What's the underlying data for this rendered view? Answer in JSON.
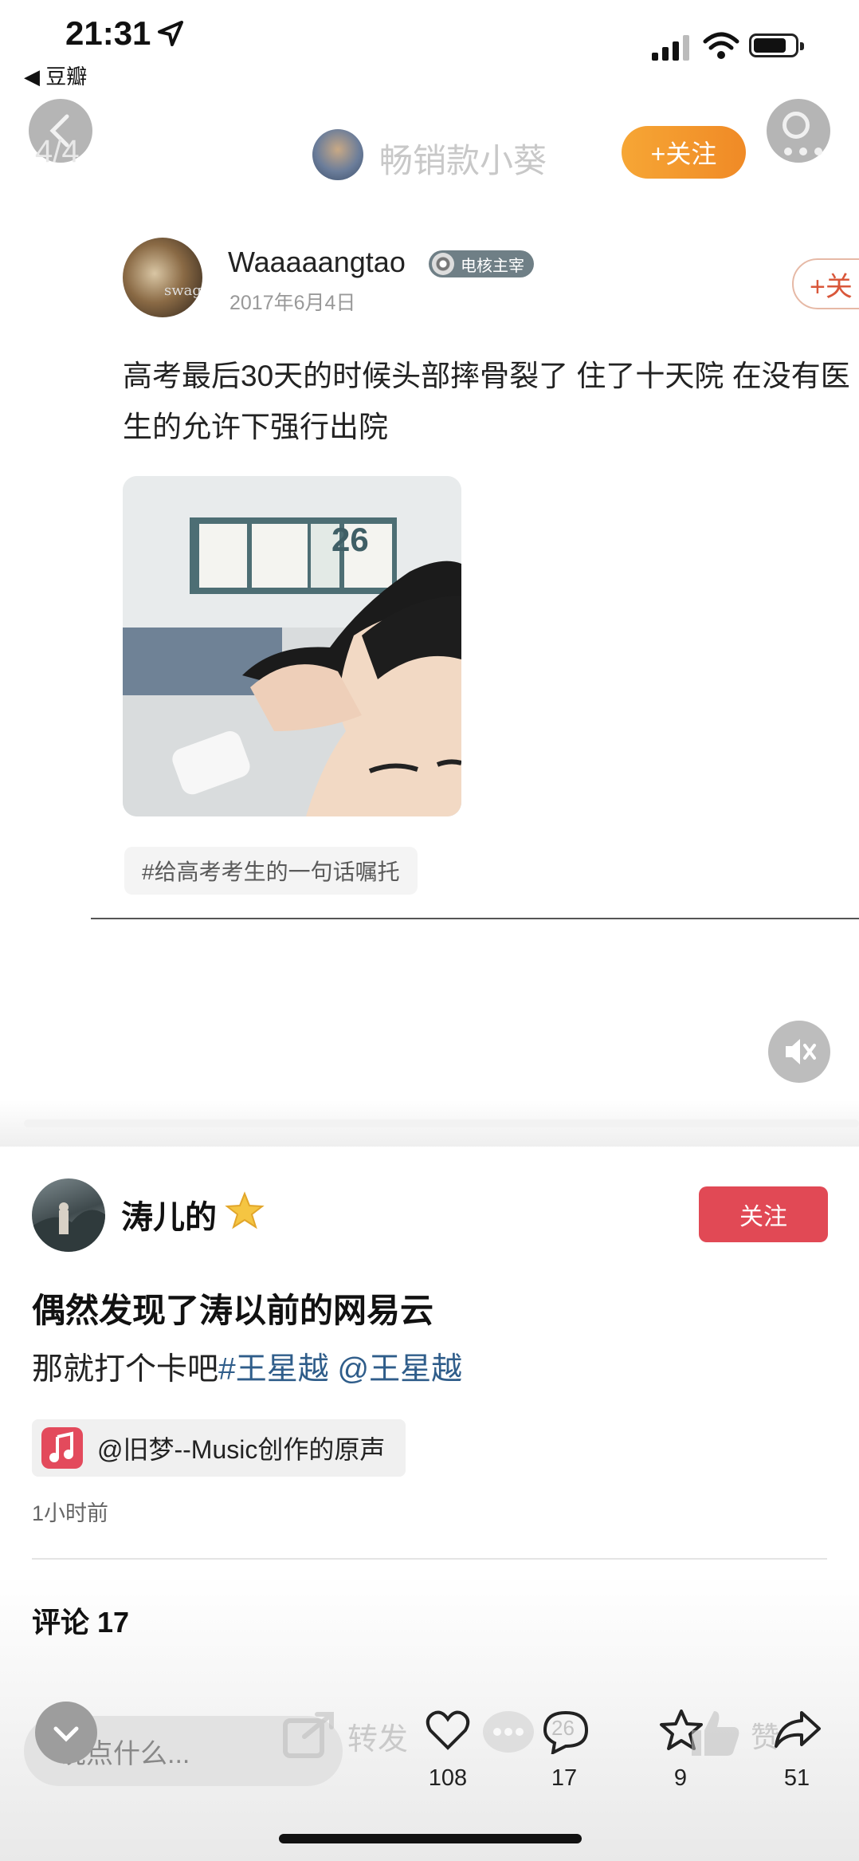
{
  "status_bar": {
    "time": "21:31",
    "back_app": "豆瓣"
  },
  "embed_header": {
    "counter": "4/4",
    "author_name": "畅销款小葵",
    "follow_label": "+关注"
  },
  "quoted_post": {
    "author": "Waaaaangtao",
    "badge": "电核主宰",
    "date": "2017年6月4日",
    "follow_label": "+关",
    "text": "高考最后30天的时候头部摔骨裂了 住了十天院 在没有医\n生的允许下强行出院",
    "photo_sign_number": "26",
    "hashtag": "#给高考考生的一句话嘱托"
  },
  "post": {
    "username": "涛儿的",
    "follow_label": "关注",
    "title": "偶然发现了涛以前的网易云",
    "body_prefix": "那就打个卡吧",
    "topic": "#王星越",
    "mention": " @王星越",
    "music": "@旧梦--Music创作的原声",
    "time_ago": "1小时前",
    "comments_label": "评论 17"
  },
  "bottom_bar": {
    "input_placeholder": "说点什么...",
    "forward_label": "转发",
    "like_count": "108",
    "comment_count": "17",
    "favorite_count": "9",
    "zan_label": "赞",
    "share_count": "51",
    "ghost_count": "26"
  },
  "colors": {
    "follow_orange": "#f39a2e",
    "follow_red": "#e14955",
    "link_blue": "#2f5d8a",
    "music_red": "#e34a5c"
  }
}
